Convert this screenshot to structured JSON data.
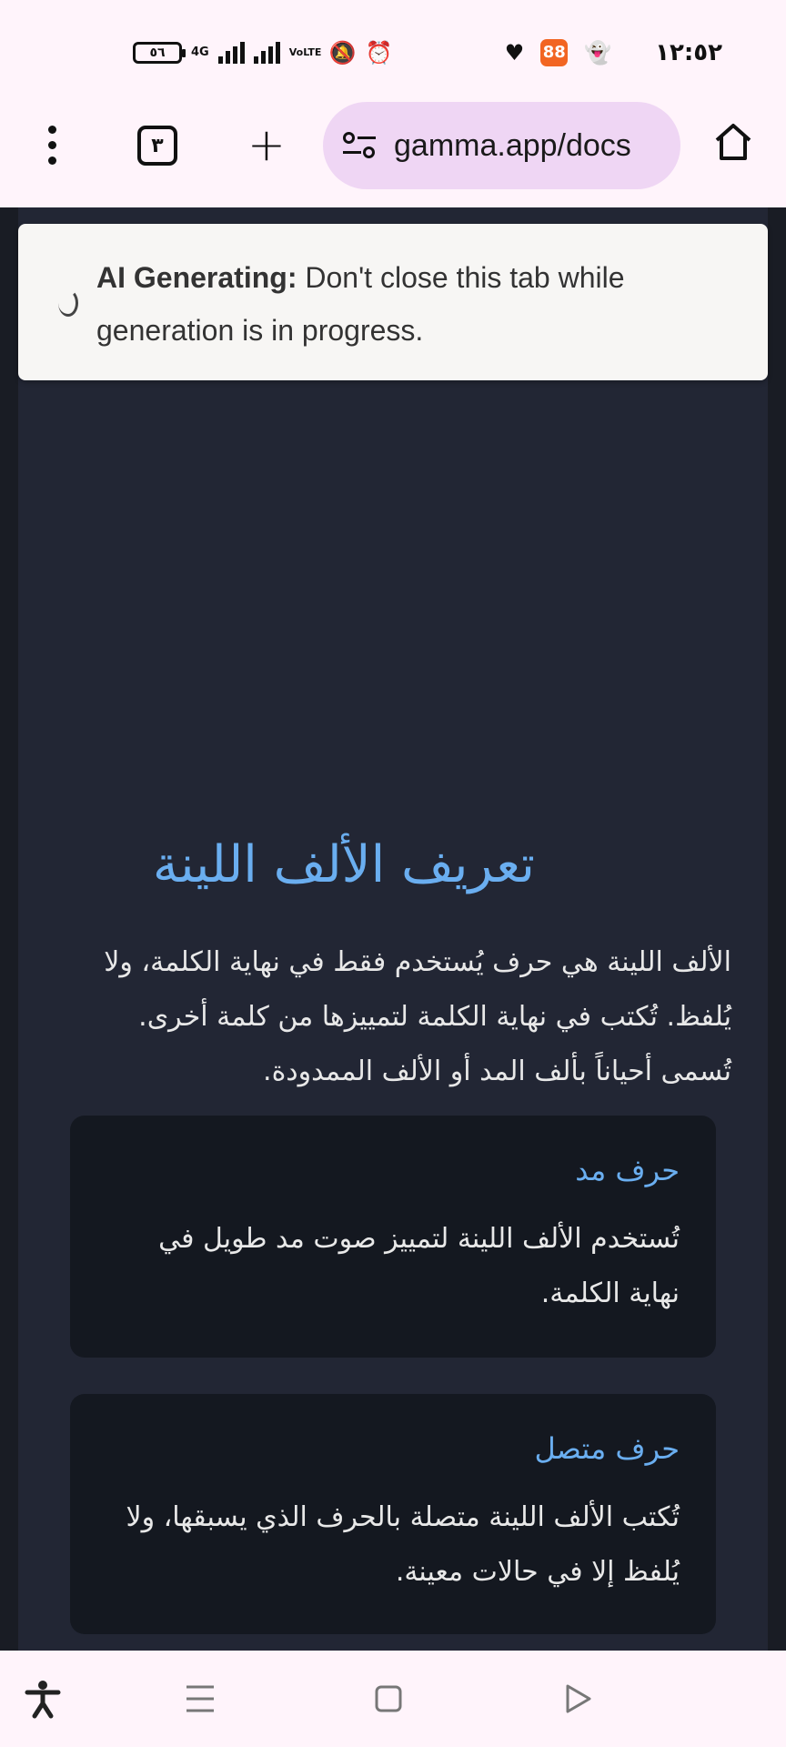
{
  "status_bar": {
    "battery": "٥٦",
    "network": "4G",
    "volte": "VoLTE",
    "time": "١٢:٥٢",
    "app_badge": "88"
  },
  "browser": {
    "tab_count": "٣",
    "url": "gamma.app/docs"
  },
  "notice": {
    "label": "AI Generating:",
    "message": "Don't close this tab while generation is in progress."
  },
  "content": {
    "heading": "تعريف الألف اللينة",
    "intro": "الألف اللينة هي حرف يُستخدم فقط في نهاية الكلمة، ولا يُلفظ. تُكتب في نهاية الكلمة لتمييزها من كلمة أخرى. تُسمى أحياناً بألف المد أو الألف الممدودة.",
    "cards": [
      {
        "title": "حرف مد",
        "body": "تُستخدم الألف اللينة لتمييز صوت مد طويل في نهاية الكلمة."
      },
      {
        "title": "حرف متصل",
        "body": "تُكتب الألف اللينة متصلة بالحرف الذي يسبقها، ولا يُلفظ إلا في حالات معينة."
      }
    ]
  },
  "colors": {
    "accent": "#6aaef0",
    "page_bg": "#222634",
    "card_bg": "#141820",
    "chrome_bg": "#fff4fb",
    "url_bar_bg": "#efd6f4"
  }
}
